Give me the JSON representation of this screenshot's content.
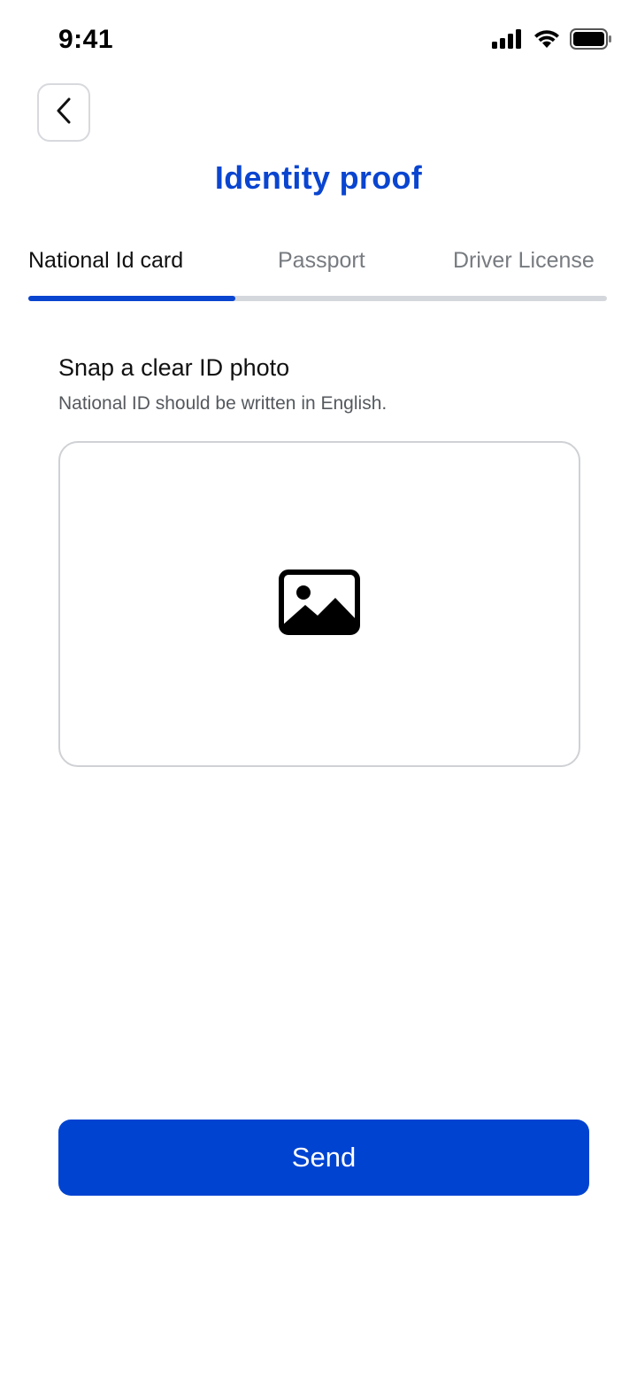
{
  "status_bar": {
    "time": "9:41",
    "icons": [
      "cellular-signal-icon",
      "wifi-icon",
      "battery-icon"
    ]
  },
  "header": {
    "back_icon": "chevron-left-icon",
    "title": "Identity proof"
  },
  "tabs": [
    {
      "label": "National Id card",
      "active": true
    },
    {
      "label": "Passport",
      "active": false
    },
    {
      "label": "Driver License",
      "active": false
    }
  ],
  "main": {
    "title": "Snap a clear ID photo",
    "subtitle": "National ID should be written in English.",
    "upload_icon": "image-placeholder-icon"
  },
  "footer": {
    "send_label": "Send"
  },
  "colors": {
    "accent": "#0043d1",
    "title": "#0a45d0",
    "tab_inactive": "#777b80",
    "tab_track": "#d4d7dc",
    "border": "#cfd1d5"
  }
}
